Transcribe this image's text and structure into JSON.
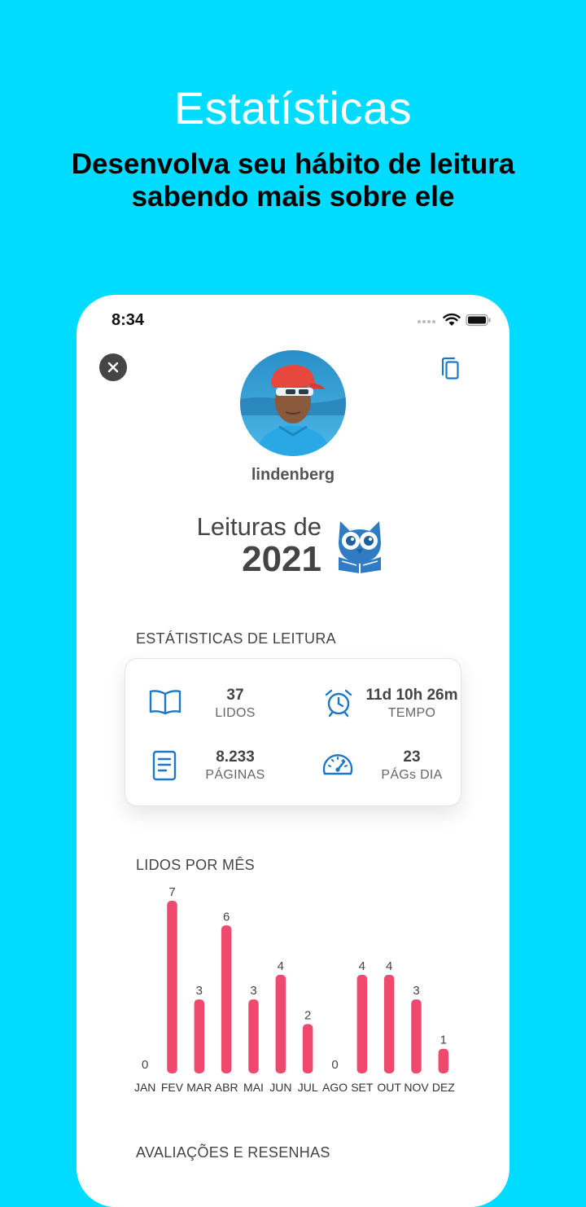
{
  "promo": {
    "title": "Estatísticas",
    "subtitle": "Desenvolva seu hábito de leitura sabendo mais sobre ele"
  },
  "status_bar": {
    "time": "8:34"
  },
  "profile": {
    "username": "lindenberg"
  },
  "year_card": {
    "caption": "Leituras de",
    "year": "2021"
  },
  "stats": {
    "heading": "ESTÁTISTICAS DE LEITURA",
    "items": [
      {
        "icon": "open-book-icon",
        "value": "37",
        "label": "LIDOS"
      },
      {
        "icon": "alarm-clock-icon",
        "value": "11d 10h 26m",
        "label": "TEMPO"
      },
      {
        "icon": "document-icon",
        "value": "8.233",
        "label": "PÁGINAS"
      },
      {
        "icon": "speedometer-icon",
        "value": "23",
        "label": "PÁGs DIA"
      }
    ]
  },
  "monthly": {
    "heading": "LIDOS POR MÊS"
  },
  "reviews": {
    "heading": "AVALIAÇÕES E RESENHAS"
  },
  "colors": {
    "background": "#00dcff",
    "accent_blue": "#1b78c8",
    "bar": "#ef4a6e"
  },
  "chart_data": {
    "type": "bar",
    "categories": [
      "JAN",
      "FEV",
      "MAR",
      "ABR",
      "MAI",
      "JUN",
      "JUL",
      "AGO",
      "SET",
      "OUT",
      "NOV",
      "DEZ"
    ],
    "values": [
      0,
      7,
      3,
      6,
      3,
      4,
      2,
      0,
      4,
      4,
      3,
      1
    ],
    "title": "LIDOS POR MÊS",
    "xlabel": "",
    "ylabel": "",
    "ylim": [
      0,
      7
    ],
    "grid": false
  }
}
